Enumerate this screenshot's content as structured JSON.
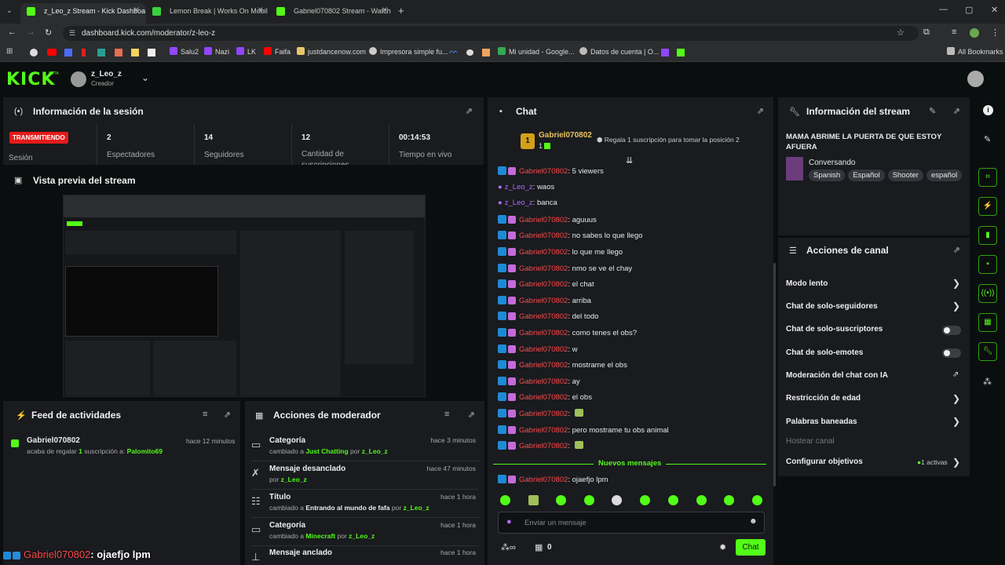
{
  "browser": {
    "tabs": [
      {
        "label": "z_Leo_z Stream - Kick Dashboa"
      },
      {
        "label": "Lemon Break | Works On Mobil"
      },
      {
        "label": "Gabriel070802 Stream - Watch"
      }
    ],
    "url": "dashboard.kick.com/moderator/z-leo-z",
    "bookmarks": [
      "Salu2",
      "Nazi",
      "LK",
      "Faifa",
      "justdancenow.com",
      "Impresora simple fu...",
      "Mi unidad - Google...",
      "Datos de cuenta | O..."
    ],
    "all_bookmarks": "All Bookmarks"
  },
  "header": {
    "logo": "KICK",
    "logo_sup": "BETA",
    "user": "z_Leo_z",
    "role": "Creador"
  },
  "session": {
    "title": "Información de la sesión",
    "live_badge": "TRANSMITIENDO",
    "live_label": "Sesión",
    "stats": [
      {
        "value": "2",
        "label": "Espectadores"
      },
      {
        "value": "14",
        "label": "Seguidores"
      },
      {
        "value": "12",
        "label": "Cantidad de suscripciones"
      },
      {
        "value": "00:14:53",
        "label": "Tiempo en vivo"
      }
    ]
  },
  "preview": {
    "title": "Vista previa del stream"
  },
  "feed": {
    "title": "Feed de actividades",
    "items": [
      {
        "user": "Gabriel070802",
        "time": "hace 12 minutos",
        "text1": "acaba de regalar",
        "count": "1",
        "text2": "suscripción a:",
        "target": "Palomito69"
      }
    ]
  },
  "mod_actions": {
    "title": "Acciones de moderador",
    "items": [
      {
        "title": "Categoría",
        "time": "hace 3 minutos",
        "pre": "cambiado a",
        "value": "Just Chatting",
        "by": "por",
        "user": "z_Leo_z"
      },
      {
        "title": "Mensaje desanclado",
        "time": "hace 47 minutos",
        "pre": "",
        "value": "",
        "by": "por",
        "user": "z_Leo_z"
      },
      {
        "title": "Título",
        "time": "hace 1 hora",
        "pre": "cambiado a",
        "value": "Entrando al mundo de fafa",
        "by": "por",
        "user": "z_Leo_z"
      },
      {
        "title": "Categoría",
        "time": "hace 1 hora",
        "pre": "cambiado a",
        "value": "Minecraft",
        "by": "por",
        "user": "z_Leo_z"
      },
      {
        "title": "Mensaje anclado",
        "time": "hace 1 hora",
        "pre": "",
        "value": "",
        "by": "",
        "user": ""
      }
    ]
  },
  "chat": {
    "title": "Chat",
    "top_gifter": "Gabriel070802",
    "top_gifter_count": "1",
    "gift_prompt": "Regala 1 suscripción para tomar la posición 2",
    "messages": [
      {
        "user": "Gabriel070802",
        "text": ": 5 viewers",
        "type": "sub"
      },
      {
        "user": "z_Leo_z",
        "text": ": waos",
        "type": "host"
      },
      {
        "user": "z_Leo_z",
        "text": ": banca",
        "type": "host"
      },
      {
        "user": "Gabriel070802",
        "text": ": aguuus",
        "type": "sub"
      },
      {
        "user": "Gabriel070802",
        "text": ": no sabes lo que llego",
        "type": "sub"
      },
      {
        "user": "Gabriel070802",
        "text": ": lo que me llego",
        "type": "sub"
      },
      {
        "user": "Gabriel070802",
        "text": ": nmo se ve el chay",
        "type": "sub"
      },
      {
        "user": "Gabriel070802",
        "text": ": el chat",
        "type": "sub"
      },
      {
        "user": "Gabriel070802",
        "text": ": arriba",
        "type": "sub"
      },
      {
        "user": "Gabriel070802",
        "text": ": del todo",
        "type": "sub"
      },
      {
        "user": "Gabriel070802",
        "text": ": como tenes el obs?",
        "type": "sub"
      },
      {
        "user": "Gabriel070802",
        "text": ": w",
        "type": "sub"
      },
      {
        "user": "Gabriel070802",
        "text": ": mostrame el obs",
        "type": "sub"
      },
      {
        "user": "Gabriel070802",
        "text": ": ay",
        "type": "sub"
      },
      {
        "user": "Gabriel070802",
        "text": ": el obs",
        "type": "sub"
      },
      {
        "user": "Gabriel070802",
        "text": ":",
        "type": "sub"
      },
      {
        "user": "Gabriel070802",
        "text": ": pero mostrame tu obs animal",
        "type": "sub"
      },
      {
        "user": "Gabriel070802",
        "text": ":",
        "type": "sub"
      }
    ],
    "new_messages": "Nuevos mensajes",
    "last_message": {
      "user": "Gabriel070802",
      "text": ": ojaefjo lpm"
    },
    "input_placeholder": "Enviar un mensaje",
    "points": "0",
    "send": "Chat"
  },
  "stream_info": {
    "title": "Información del stream",
    "stream_title": "MAMA ABRIME LA PUERTA DE QUE ESTOY AFUERA",
    "category": "Conversando",
    "tags": [
      "Spanish",
      "Español",
      "Shooter",
      "español"
    ]
  },
  "channel_actions": {
    "title": "Acciones de canal",
    "items": [
      {
        "label": "Modo lento",
        "control": "chevron"
      },
      {
        "label": "Chat de solo-seguidores",
        "control": "chevron"
      },
      {
        "label": "Chat de solo-suscriptores",
        "control": "toggle"
      },
      {
        "label": "Chat de solo-emotes",
        "control": "toggle"
      },
      {
        "label": "Moderación del chat con IA",
        "control": "external"
      },
      {
        "label": "Restricción de edad",
        "control": "chevron"
      },
      {
        "label": "Palabras baneadas",
        "control": "chevron"
      },
      {
        "label": "Hostear canal",
        "control": "disabled"
      },
      {
        "label": "Configurar objetivos",
        "control": "chevron"
      }
    ],
    "goals_active": "1 activas"
  },
  "overlay": {
    "user": "Gabriel070802",
    "text": ": ojaefjo lpm"
  }
}
